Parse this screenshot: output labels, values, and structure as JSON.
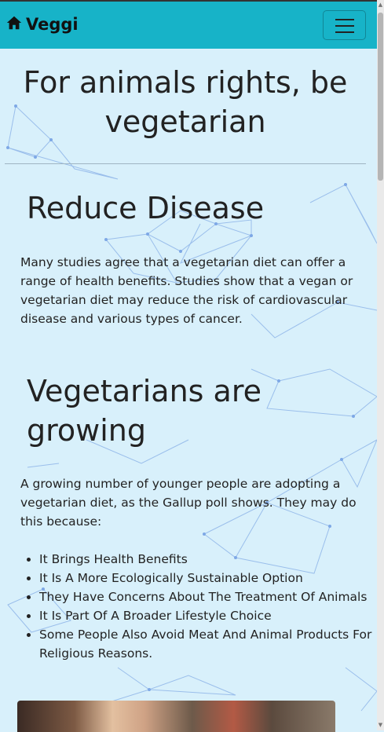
{
  "navbar": {
    "brand": "Veggi",
    "home_icon": "home-icon",
    "menu_icon": "hamburger-menu-icon",
    "background": "#17b3c8"
  },
  "hero": {
    "title": "For animals rights, be vegetarian"
  },
  "sections": {
    "disease": {
      "heading": "Reduce Disease",
      "text": "Many studies agree that a vegetarian diet can offer a range of health benefits. Studies show that a vegan or vegetarian diet may reduce the risk of cardiovascular disease and various types of cancer."
    },
    "growing": {
      "heading": "Vegetarians are growing",
      "text": "A growing number of younger people are adopting a vegetarian diet, as the Gallup poll shows. They may do this because:",
      "reasons": [
        "It Brings Health Benefits",
        "It Is A More Ecologically Sustainable Option",
        "They Have Concerns About The Treatment Of Animals",
        "It Is Part Of A Broader Lifestyle Choice",
        "Some People Also Avoid Meat And Animal Products For Religious Reasons."
      ]
    }
  },
  "colors": {
    "page_background": "#d8f0fb",
    "network_lines": "#7fa8e0"
  }
}
